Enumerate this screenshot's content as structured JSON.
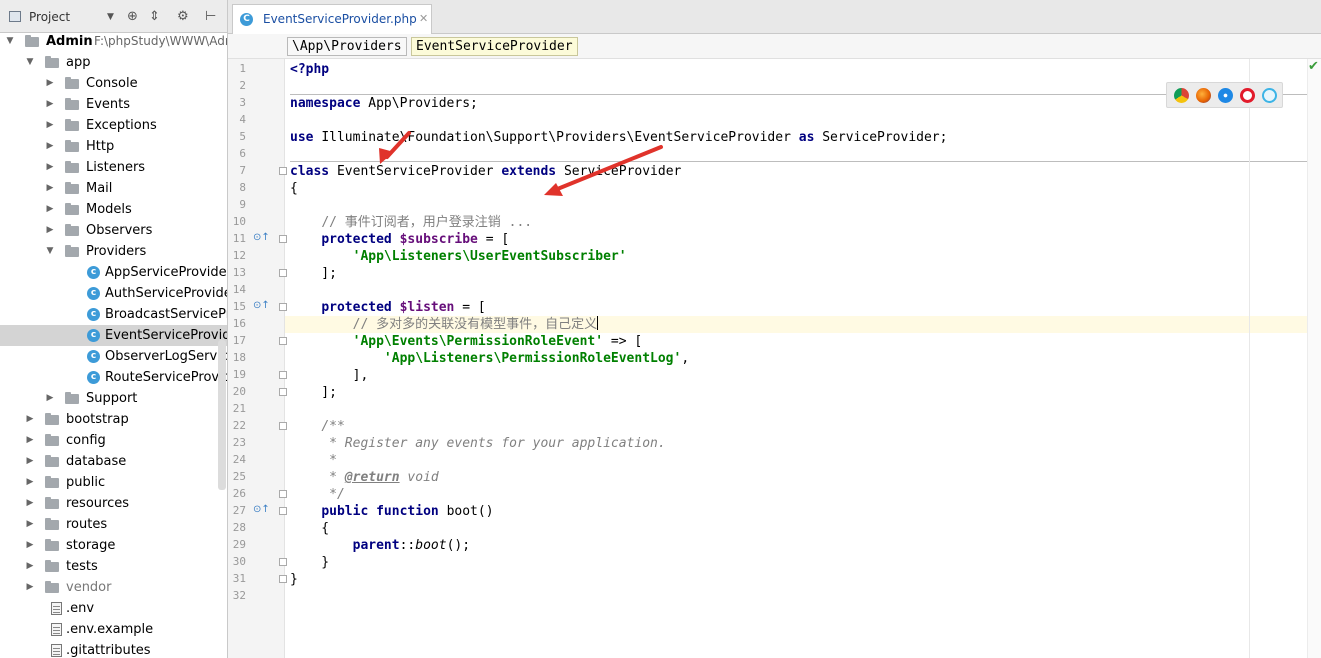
{
  "sidebar": {
    "header": {
      "title": "Project"
    },
    "tree": [
      {
        "label": "Admin",
        "path": "F:\\phpStudy\\WWW\\Admin",
        "type": "root-folder",
        "indent": 0,
        "expanded": true
      },
      {
        "label": "app",
        "type": "folder",
        "indent": 1,
        "expanded": true
      },
      {
        "label": "Console",
        "type": "folder",
        "indent": 2
      },
      {
        "label": "Events",
        "type": "folder",
        "indent": 2
      },
      {
        "label": "Exceptions",
        "type": "folder",
        "indent": 2
      },
      {
        "label": "Http",
        "type": "folder",
        "indent": 2
      },
      {
        "label": "Listeners",
        "type": "folder",
        "indent": 2
      },
      {
        "label": "Mail",
        "type": "folder",
        "indent": 2
      },
      {
        "label": "Models",
        "type": "folder",
        "indent": 2
      },
      {
        "label": "Observers",
        "type": "folder",
        "indent": 2
      },
      {
        "label": "Providers",
        "type": "folder",
        "indent": 2,
        "expanded": true
      },
      {
        "label": "AppServiceProvider.php",
        "type": "class",
        "indent": 3
      },
      {
        "label": "AuthServiceProvider.php",
        "type": "class",
        "indent": 3
      },
      {
        "label": "BroadcastServiceProvider.php",
        "type": "class",
        "indent": 3
      },
      {
        "label": "EventServiceProvider.php",
        "type": "class",
        "indent": 3,
        "selected": true
      },
      {
        "label": "ObserverLogServiceProvider.php",
        "type": "class",
        "indent": 3
      },
      {
        "label": "RouteServiceProvider.php",
        "type": "class",
        "indent": 3
      },
      {
        "label": "Support",
        "type": "folder",
        "indent": 2
      },
      {
        "label": "bootstrap",
        "type": "folder",
        "indent": 1
      },
      {
        "label": "config",
        "type": "folder",
        "indent": 1
      },
      {
        "label": "database",
        "type": "folder",
        "indent": 1
      },
      {
        "label": "public",
        "type": "folder",
        "indent": 1
      },
      {
        "label": "resources",
        "type": "folder",
        "indent": 1
      },
      {
        "label": "routes",
        "type": "folder",
        "indent": 1
      },
      {
        "label": "storage",
        "type": "folder",
        "indent": 1
      },
      {
        "label": "tests",
        "type": "folder",
        "indent": 1
      },
      {
        "label": "vendor",
        "type": "folder",
        "indent": 1,
        "muted": true
      },
      {
        "label": ".env",
        "type": "file",
        "indent": 1
      },
      {
        "label": ".env.example",
        "type": "file",
        "indent": 1
      },
      {
        "label": ".gitattributes",
        "type": "file",
        "indent": 1
      }
    ]
  },
  "editor": {
    "tab": {
      "label": "EventServiceProvider.php",
      "icon": "php-class-icon"
    },
    "breadcrumbs": [
      "\\App\\Providers",
      "EventServiceProvider"
    ],
    "current_line": 16,
    "line_count": 32
  },
  "code": {
    "l1": "<?php",
    "l3_ns": "App\\Providers;",
    "l5_use": "Illuminate\\Foundation\\Support\\Providers\\EventServiceProvider",
    "l5_alias": "ServiceProvider;",
    "l7_class": "EventServiceProvider",
    "l7_parent": "ServiceProvider",
    "l10_comment": "// 事件订阅者，用户登录注销 ...",
    "l11_var": "$subscribe",
    "l12_str": "'App\\Listeners\\UserEventSubscriber'",
    "l15_var": "$listen",
    "l16_comment": "// 多对多的关联没有模型事件，自己定义",
    "l17_str": "'App\\Events\\PermissionRoleEvent'",
    "l18_str": "'App\\Listeners\\PermissionRoleEventLog'",
    "l22": "/**",
    "l23": " * Register any events for your application.",
    "l24": " *",
    "l25_star": " * ",
    "l25_tag": "@return",
    "l25_type": " void",
    "l26": " */",
    "l27_fn": "boot()",
    "l29_call": "boot",
    "l31": "}"
  },
  "browsers": [
    "chrome-icon",
    "firefox-icon",
    "safari-icon",
    "opera-icon",
    "ie-icon"
  ],
  "colors": {
    "keyword": "#000080",
    "string": "#008000",
    "variable": "#660e7a",
    "comment": "#808080",
    "selection": "#d4d4d4",
    "current_line": "#fffae3",
    "annotation_arrow": "#e0332b"
  }
}
